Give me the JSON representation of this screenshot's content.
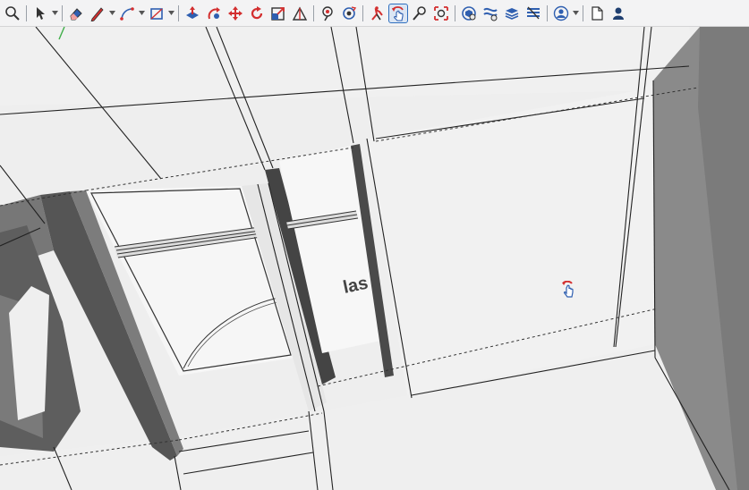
{
  "toolbar": {
    "buttons": [
      {
        "name": "zoom-icon",
        "dropdown": false
      },
      {
        "name": "select-arrow-icon",
        "dropdown": true
      },
      {
        "name": "eraser-icon",
        "dropdown": false
      },
      {
        "name": "pencil-line-icon",
        "dropdown": true
      },
      {
        "name": "arc-icon",
        "dropdown": true
      },
      {
        "name": "rectangle-icon",
        "dropdown": true
      },
      {
        "name": "push-pull-icon",
        "dropdown": false
      },
      {
        "name": "follow-me-icon",
        "dropdown": false
      },
      {
        "name": "move-icon",
        "dropdown": false
      },
      {
        "name": "rotate-icon",
        "dropdown": false
      },
      {
        "name": "scale-icon",
        "dropdown": false
      },
      {
        "name": "protractor-icon",
        "dropdown": false
      },
      {
        "name": "position-camera-icon",
        "dropdown": false
      },
      {
        "name": "look-around-icon",
        "dropdown": false
      },
      {
        "name": "walk-icon",
        "dropdown": false
      },
      {
        "name": "orbit-icon",
        "dropdown": false,
        "active": true
      },
      {
        "name": "pan-icon",
        "dropdown": false
      },
      {
        "name": "zoom-extents-icon",
        "dropdown": false
      },
      {
        "name": "components-icon",
        "dropdown": false
      },
      {
        "name": "styles-icon",
        "dropdown": false
      },
      {
        "name": "layers-icon",
        "dropdown": false
      },
      {
        "name": "tags-icon",
        "dropdown": false
      },
      {
        "name": "account-icon",
        "dropdown": true
      },
      {
        "name": "new-file-icon",
        "dropdown": false
      },
      {
        "name": "user-icon",
        "dropdown": false
      }
    ],
    "accent_color": "#2f6fbf",
    "icon_red": "#d32f2f"
  },
  "viewport": {
    "label_text": "las",
    "cursor_icon": "orbit-hand-cursor-icon"
  }
}
